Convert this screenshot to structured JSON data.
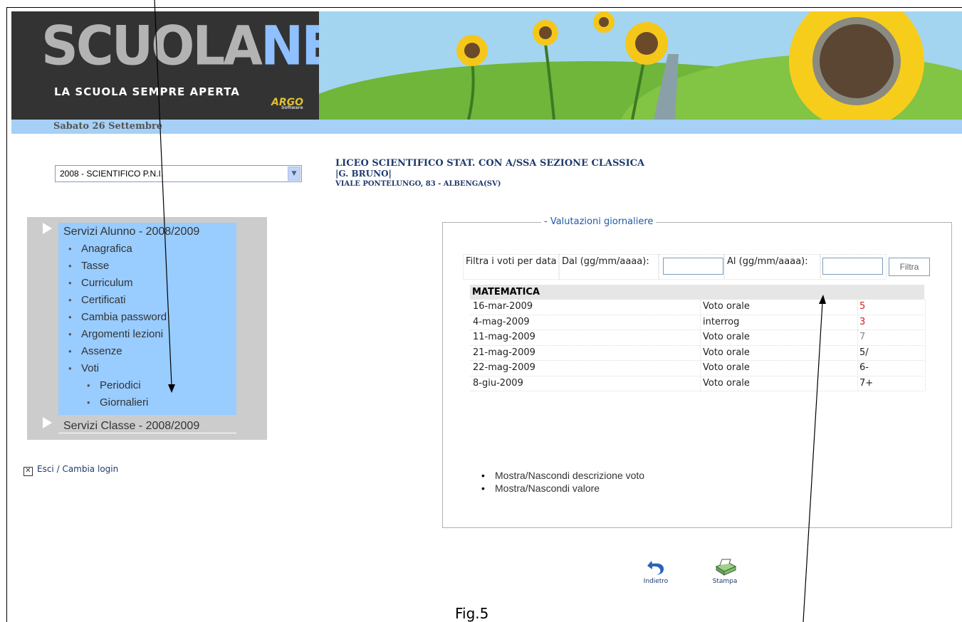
{
  "header": {
    "logo_main": "SCUOLA",
    "logo_accent": "NET",
    "tagline": "LA SCUOLA SEMPRE APERTA",
    "vendor_logo": "ARGO",
    "vendor_sub": "Software",
    "date": "Sabato 26 Settembre"
  },
  "school": {
    "name": "LICEO SCIENTIFICO STAT. CON A/SSA SEZIONE CLASSICA",
    "subname": "|G. BRUNO|",
    "address": "VIALE PONTELUNGO, 83 - ALBENGA(SV)"
  },
  "year_select": {
    "value": "2008 - SCIENTIFICO P.N.I."
  },
  "menu": {
    "section1_title": "Servizi Alunno - 2008/2009",
    "items": [
      "Anagrafica",
      "Tasse",
      "Curriculum",
      "Certificati",
      "Cambia password",
      "Argomenti lezioni",
      "Assenze",
      "Voti"
    ],
    "subitems": [
      "Periodici",
      "Giornalieri"
    ],
    "section2_title": "Servizi Classe - 2008/2009"
  },
  "logout": {
    "label": "Esci / Cambia login"
  },
  "panel": {
    "legend": "- Valutazioni giornaliere",
    "filter_label": "Filtra i voti per data",
    "from_label": "Dal (gg/mm/aaaa):",
    "to_label": "Al (gg/mm/aaaa):",
    "from_value": "",
    "to_value": "",
    "filter_button": "Filtra",
    "subject": "MATEMATICA",
    "grades": [
      {
        "date": "16-mar-2009",
        "type": "Voto orale",
        "value": "5",
        "color": "#cc2222"
      },
      {
        "date": "4-mag-2009",
        "type": "interrog",
        "value": "3",
        "color": "#cc2222"
      },
      {
        "date": "11-mag-2009",
        "type": "Voto orale",
        "value": "7",
        "color": "#888888"
      },
      {
        "date": "21-mag-2009",
        "type": "Voto orale",
        "value": "5/",
        "color": "#222222"
      },
      {
        "date": "22-mag-2009",
        "type": "Voto orale",
        "value": "6-",
        "color": "#222222"
      },
      {
        "date": "8-giu-2009",
        "type": "Voto orale",
        "value": "7+",
        "color": "#222222"
      }
    ],
    "links": [
      "Mostra/Nascondi descrizione voto",
      "Mostra/Nascondi valore"
    ]
  },
  "actions": {
    "back_label": "Indietro",
    "print_label": "Stampa"
  },
  "caption": "Fig.5",
  "icons": [
    "select-arrow-icon",
    "menu-triangle-icon",
    "close-box-icon",
    "back-arrow-icon",
    "printer-icon"
  ]
}
